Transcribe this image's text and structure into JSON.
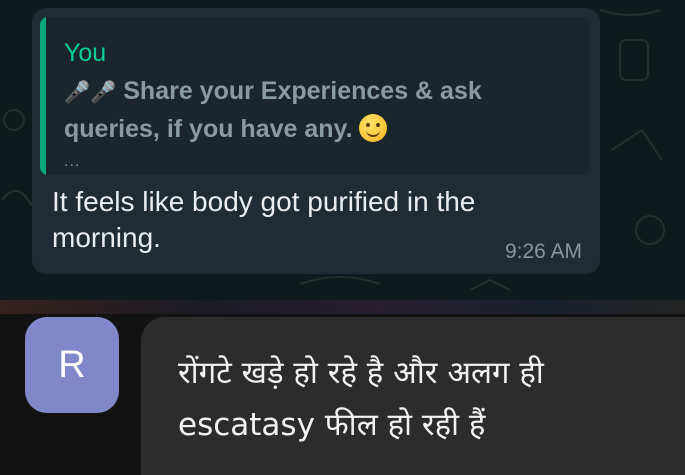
{
  "chat": {
    "quote": {
      "author": "You",
      "text_prefix": "🎤🎤",
      "text": " Share your Experiences & ask queries, if you have any. ",
      "emoji": "smiling-face",
      "ellipsis": "..."
    },
    "message": {
      "text": "It feels like body got purified in the morning.",
      "time": "9:26 AM"
    }
  },
  "reply": {
    "avatar_letter": "R",
    "text": "रोंगटे खड़े हो रहे है और अलग ही escatasy फील हो रही हैं"
  },
  "colors": {
    "quote_accent": "#06a77d",
    "bubble": "#1f2c33",
    "avatar": "#8088c9"
  }
}
